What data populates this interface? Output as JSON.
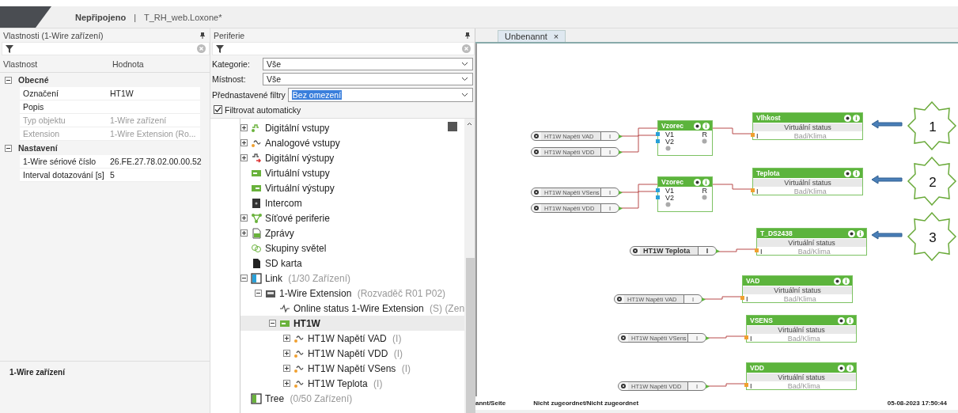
{
  "title_bar": {
    "status": "Nepřipojeno",
    "separator": "|",
    "project": "T_RH_web.Loxone*"
  },
  "properties_panel": {
    "title": "Vlastnosti (1-Wire zařízení)",
    "columns": [
      "Vlastnost",
      "Hodnota"
    ],
    "groups": [
      {
        "name": "Obecné",
        "expanded": true,
        "rows": [
          {
            "label": "Označení",
            "value": "HT1W",
            "disabled": false
          },
          {
            "label": "Popis",
            "disabled": false
          },
          {
            "label": "Typ objektu",
            "value": "1-Wire zařízení",
            "disabled": true
          },
          {
            "label": "Extension",
            "value": "1-Wire Extension (Ro...",
            "disabled": true
          }
        ]
      },
      {
        "name": "Nastavení",
        "expanded": true,
        "rows": [
          {
            "label": "1-Wire sériové číslo",
            "value": "26.FE.27.78.02.00.00.52",
            "disabled": false
          },
          {
            "label": "Interval dotazování [s]",
            "value": "5",
            "disabled": false
          }
        ]
      }
    ],
    "description_title": "1-Wire zařízení"
  },
  "periphery_panel": {
    "title": "Periferie",
    "filters": [
      {
        "label": "Kategorie:",
        "value": "Vše"
      },
      {
        "label": "Místnost:",
        "value": "Vše"
      }
    ],
    "preset": {
      "label": "Přednastavené filtry",
      "value": "Bez omezení",
      "highlighted": true
    },
    "auto_filter": {
      "label": "Filtrovat automaticky",
      "checked": true
    },
    "tree": [
      {
        "label": "Digitální vstupy",
        "kind": "digital-in",
        "expanded": false,
        "selected": false
      },
      {
        "label": "Analogové vstupy",
        "kind": "analog-in",
        "expanded": false,
        "selected": false
      },
      {
        "label": "Digitální výstupy",
        "kind": "digital-out",
        "expanded": false,
        "selected": false
      },
      {
        "label": "Virtuální vstupy",
        "kind": "virtual-in",
        "selected": false
      },
      {
        "label": "Virtuální výstupy",
        "kind": "virtual-out",
        "selected": false
      },
      {
        "label": "Intercom",
        "kind": "intercom",
        "selected": false
      },
      {
        "label": "Síťové periferie",
        "kind": "network",
        "expanded": false,
        "selected": false
      },
      {
        "label": "Zprávy",
        "kind": "messages",
        "expanded": false,
        "selected": false
      },
      {
        "label": "Skupiny světel",
        "kind": "lights",
        "selected": false
      },
      {
        "label": "SD karta",
        "kind": "sd-card",
        "selected": false
      },
      {
        "label": "Link",
        "note": "(1/30 Zařízení)",
        "kind": "link",
        "expanded": true,
        "selected": false,
        "children": [
          {
            "label": "1-Wire Extension",
            "note": "(Rozvaděč R01 P02)",
            "kind": "extension",
            "expanded": true,
            "selected": false,
            "children": [
              {
                "label": "Online status 1-Wire Extension",
                "note": "(S) (Zen",
                "kind": "status",
                "selected": false
              },
              {
                "label": "HT1W",
                "kind": "device",
                "expanded": true,
                "selected": true,
                "children": [
                  {
                    "label": "HT1W Napětí VAD",
                    "note": "(I)",
                    "kind": "analog-in",
                    "expanded": false,
                    "selected": false
                  },
                  {
                    "label": "HT1W Napětí VDD",
                    "note": "(I)",
                    "kind": "analog-in",
                    "expanded": false,
                    "selected": false
                  },
                  {
                    "label": "HT1W Napětí VSens",
                    "note": "(I)",
                    "kind": "analog-in",
                    "expanded": false,
                    "selected": false
                  },
                  {
                    "label": "HT1W Teplota",
                    "note": "(I)",
                    "kind": "analog-in",
                    "expanded": false,
                    "selected": false
                  }
                ]
              }
            ]
          }
        ]
      },
      {
        "label": "Tree",
        "note": "(0/50 Zařízení)",
        "kind": "tree",
        "selected": false
      }
    ]
  },
  "canvas": {
    "tab": {
      "label": "Unbenannt",
      "close": "×"
    },
    "inputs": [
      {
        "label": "HT1W Napětí VAD",
        "value": "I",
        "kind": "small"
      },
      {
        "label": "HT1W Napětí VDD",
        "value": "I",
        "kind": "small"
      },
      {
        "label": "HT1W Napětí VSens",
        "value": "I",
        "kind": "small"
      },
      {
        "label": "HT1W Napětí VDD",
        "value": "I",
        "kind": "small"
      },
      {
        "label": "HT1W Teplota",
        "value": "I",
        "kind": "large"
      },
      {
        "label": "HT1W Napětí VAD",
        "value": "I",
        "kind": "small"
      },
      {
        "label": "HT1W Napětí VSens",
        "value": "I",
        "kind": "small"
      },
      {
        "label": "HT1W Napětí VDD",
        "value": "I",
        "kind": "small"
      }
    ],
    "formula_blocks": [
      {
        "title": "Vzorec",
        "inputs": [
          "V1",
          "V2"
        ],
        "output": "R"
      },
      {
        "title": "Vzorec",
        "inputs": [
          "V1",
          "V2"
        ],
        "output": "R"
      }
    ],
    "status_blocks": [
      {
        "title": "Vlhkost",
        "subtitle": "Virtuální status",
        "input": "I",
        "room": "Bad/Klima"
      },
      {
        "title": "Teplota",
        "subtitle": "Virtuální status",
        "input": "I",
        "room": "Bad/Klima"
      },
      {
        "title": "T_DS2438",
        "subtitle": "Virtuální status",
        "input": "I",
        "room": "Bad/Klima"
      },
      {
        "title": "VAD",
        "subtitle": "Virtuální status",
        "input": "I",
        "room": "Bad/Klima"
      },
      {
        "title": "VSENS",
        "subtitle": "Virtuální status",
        "input": "I",
        "room": "Bad/Klima"
      },
      {
        "title": "VDD",
        "subtitle": "Virtuální status",
        "input": "I",
        "room": "Bad/Klima"
      }
    ],
    "callouts": [
      {
        "number": "1"
      },
      {
        "number": "2"
      },
      {
        "number": "3"
      }
    ]
  },
  "status_bar": {
    "page": "annt/Seite",
    "assignment": "Nicht zugeordnet/Nicht zugeordnet",
    "timestamp": "05-08-2023 17:50:44"
  }
}
